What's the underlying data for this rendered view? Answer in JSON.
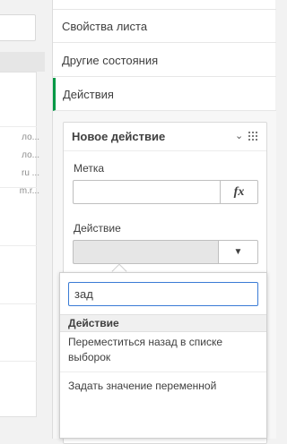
{
  "left_panel": {
    "snippets": [
      "ло...",
      "ло...",
      "ru ...",
      "m.r..."
    ]
  },
  "sections": [
    {
      "label": "Свойства листа"
    },
    {
      "label": "Другие состояния"
    },
    {
      "label": "Действия"
    }
  ],
  "action_card": {
    "title": "Новое действие",
    "label_field": {
      "label": "Метка",
      "value": "",
      "fx_button": "fx"
    },
    "action_field": {
      "label": "Действие",
      "value": ""
    }
  },
  "dropdown": {
    "search_value": "зад",
    "group_header": "Действие",
    "options": [
      {
        "label": "Переместиться назад в списке выборок"
      },
      {
        "label": "Задать значение переменной"
      }
    ]
  },
  "colors": {
    "active_section_accent": "#009845",
    "search_focus_border": "#3a7bd5"
  }
}
